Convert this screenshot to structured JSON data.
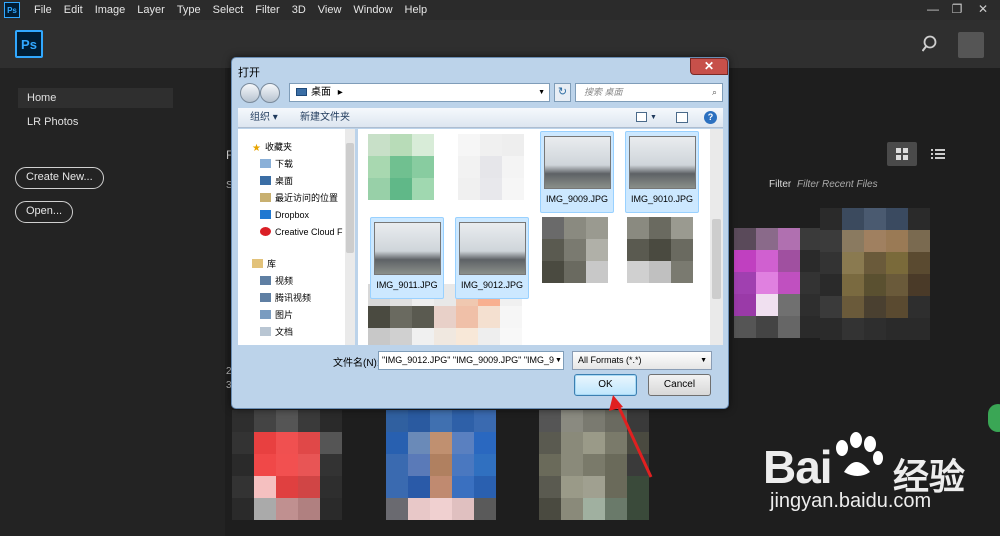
{
  "menubar": {
    "app_icon": "Ps",
    "items": [
      "File",
      "Edit",
      "Image",
      "Layer",
      "Type",
      "Select",
      "Filter",
      "3D",
      "View",
      "Window",
      "Help"
    ],
    "window_controls": [
      "—",
      "❐",
      "✕"
    ]
  },
  "appbar": {
    "logo": "Ps",
    "search_icon": "search-icon"
  },
  "sidebar": {
    "home": "Home",
    "lr_photos": "LR Photos",
    "create_new": "Create New...",
    "open": "Open..."
  },
  "main": {
    "filter_label": "Filter",
    "filter_placeholder": "Filter Recent Files",
    "partial_left": [
      "F",
      "S",
      "2",
      "3"
    ]
  },
  "dialog": {
    "title": "打开",
    "close": "✕",
    "address": "桌面",
    "address_arrow": "▸",
    "search_placeholder": "搜索 桌面",
    "toolbar": {
      "organize": "组织 ▾",
      "new_folder": "新建文件夹"
    },
    "nav": {
      "favorites_header": "收藏夹",
      "favorites": [
        "下载",
        "桌面",
        "最近访问的位置",
        "Dropbox",
        "Creative Cloud F"
      ],
      "library_header": "库",
      "library": [
        "视频",
        "腾讯视频",
        "图片",
        "文档"
      ]
    },
    "files": [
      {
        "name": "IMG_9009.JPG",
        "selected": true
      },
      {
        "name": "IMG_9010.JPG",
        "selected": true
      },
      {
        "name": "IMG_9011.JPG",
        "selected": true
      },
      {
        "name": "IMG_9012.JPG",
        "selected": true
      }
    ],
    "filename_label": "文件名(N):",
    "filename_value": "\"IMG_9012.JPG\" \"IMG_9009.JPG\" \"IMG_9",
    "filetype_value": "All Formats (*.*)",
    "ok": "OK",
    "cancel": "Cancel"
  },
  "watermark": {
    "brand": "Bai",
    "brand2": "经验",
    "url": "jingyan.baidu.com"
  },
  "colors": {
    "ps_blue": "#31a8ff",
    "dialog_frame": "#bcd3ea",
    "selection": "#cce8ff",
    "arrow_red": "#e02020"
  }
}
